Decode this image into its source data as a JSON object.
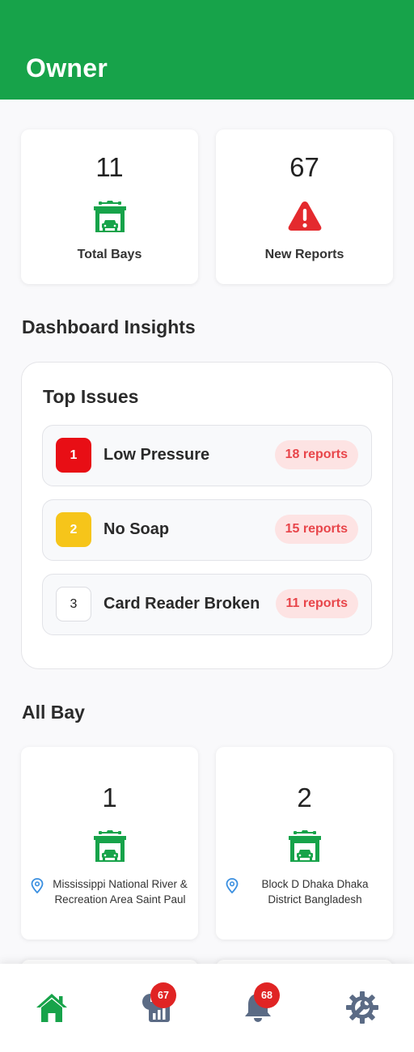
{
  "header": {
    "title": "Owner"
  },
  "stats": {
    "total_bays": {
      "value": "11",
      "label": "Total Bays",
      "icon": "garage-icon"
    },
    "new_reports": {
      "value": "67",
      "label": "New Reports",
      "icon": "warning-icon"
    }
  },
  "insights": {
    "section_title": "Dashboard Insights",
    "card_title": "Top Issues",
    "issues": [
      {
        "rank": "1",
        "name": "Low Pressure",
        "reports": "18 reports"
      },
      {
        "rank": "2",
        "name": "No Soap",
        "reports": "15 reports"
      },
      {
        "rank": "3",
        "name": "Card Reader Broken",
        "reports": "11 reports"
      }
    ]
  },
  "bays": {
    "section_title": "All Bay",
    "items": [
      {
        "number": "1",
        "address": "Mississippi National River & Recreation Area Saint Paul"
      },
      {
        "number": "2",
        "address": "Block D Dhaka Dhaka District Bangladesh"
      }
    ]
  },
  "nav": {
    "items": [
      {
        "name": "home",
        "icon": "home-icon",
        "active": true
      },
      {
        "name": "reports",
        "icon": "report-chart-icon",
        "badge": "67"
      },
      {
        "name": "notifications",
        "icon": "bell-icon",
        "badge": "68"
      },
      {
        "name": "settings",
        "icon": "settings-wrench-icon"
      }
    ]
  },
  "colors": {
    "primary": "#17a34a",
    "danger": "#e80e15",
    "warning": "#f6c51a",
    "badge_bg": "#fde3e3",
    "badge_text": "#e8454a",
    "nav_inactive": "#5b6b85"
  }
}
